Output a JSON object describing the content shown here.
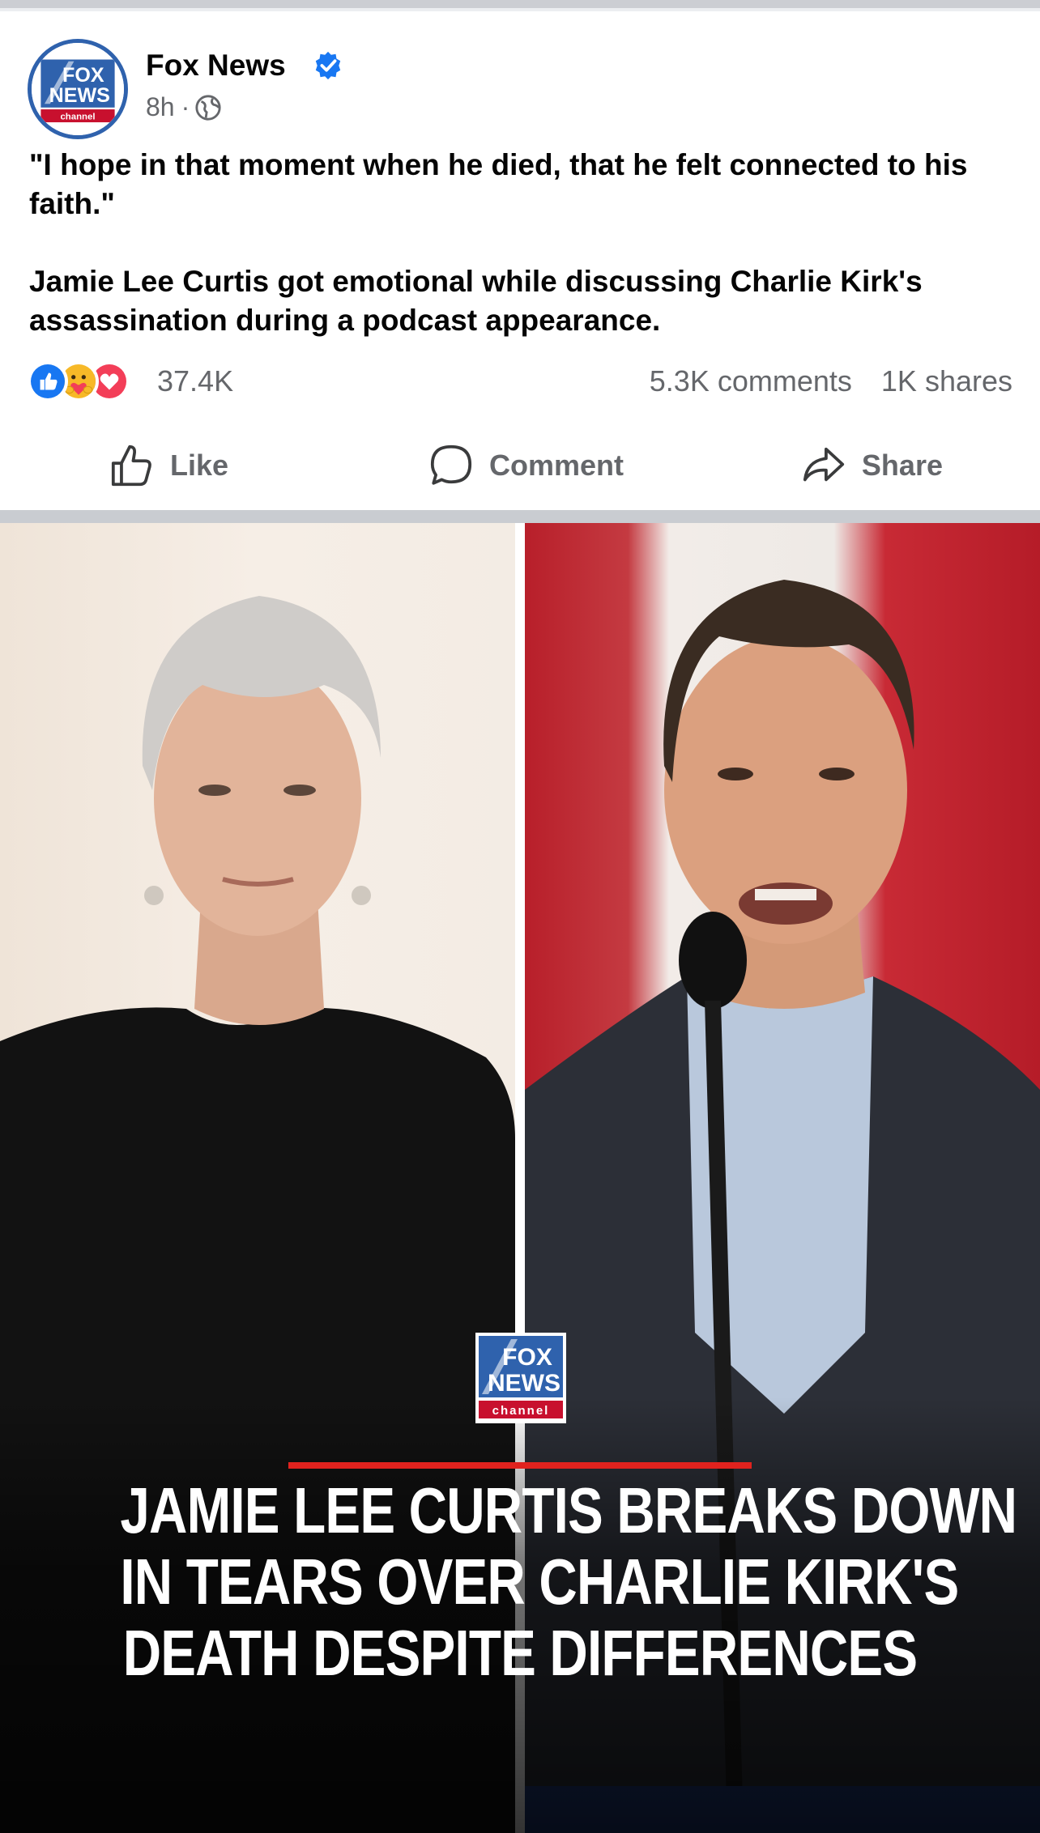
{
  "post": {
    "page_name": "Fox News",
    "verified": true,
    "time": "8h",
    "separator": "·",
    "audience": "globe-icon",
    "logo_text": {
      "line1": "FOX",
      "line2": "NEWS",
      "line3": "channel"
    },
    "caption": [
      "\"I hope in that moment when he died, that he felt connected to his faith.\"",
      "Jamie Lee Curtis got emotional while discussing Charlie Kirk's assassination during a podcast appearance."
    ]
  },
  "reactions": {
    "icons": [
      "like-reaction-icon",
      "care-reaction-icon",
      "love-reaction-icon"
    ],
    "count": "37.4K",
    "comments": "5.3K comments",
    "shares": "1K shares"
  },
  "actions": {
    "like": "Like",
    "comment": "Comment",
    "share": "Share"
  },
  "media": {
    "logo_text": {
      "line1": "FOX",
      "line2": "NEWS",
      "line3": "channel"
    },
    "headline": [
      "JAMIE LEE CURTIS BREAKS DOWN",
      "IN TEARS OVER CHARLIE KIRK'S",
      "DEATH DESPITE DIFFERENCES"
    ]
  },
  "colors": {
    "accent_blue": "#1877f2",
    "fox_blue": "#2f62ad",
    "fox_red": "#e0221e",
    "muted_text": "#65676b"
  }
}
